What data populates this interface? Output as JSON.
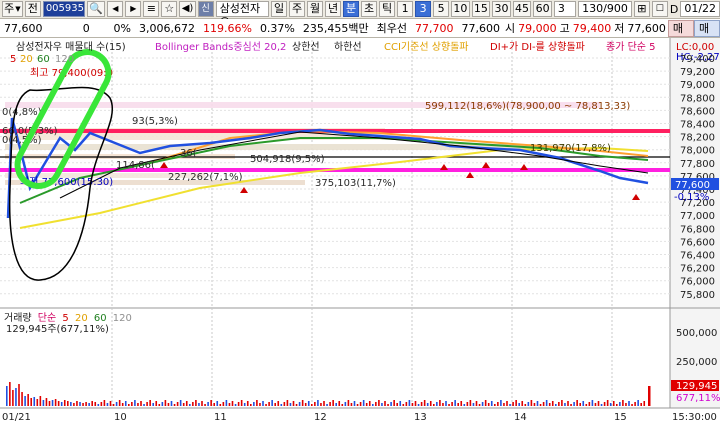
{
  "toolbar": {
    "label_ju": "주",
    "dropdown_arrow": "▼",
    "label_jeon": "전",
    "code": "005935",
    "stock_name": "삼성전자우",
    "periods": [
      "일",
      "주",
      "월",
      "년",
      "분",
      "초",
      "틱"
    ],
    "minutes": [
      "1",
      "3",
      "5",
      "10",
      "15",
      "30",
      "45",
      "60"
    ],
    "interval": "3",
    "count": "130/900",
    "date": "01/22",
    "d_label": "D"
  },
  "quote": {
    "price": "77,600",
    "change": "0",
    "change_pct": "0%",
    "volume": "3,006,672",
    "vol_ratio": "119.66%",
    "turnover_pct": "0.37%",
    "amount": "235,455백만",
    "best_label": "최우선",
    "best_ask": "77,700",
    "best_bid": "77,600",
    "open_label": "시",
    "open": "79,000",
    "high_label": "고",
    "high": "79,400",
    "low_label": "저",
    "low": "77,600",
    "buy": "매수",
    "sell": "매도"
  },
  "legend": {
    "title": "삼성전자우 매물대 수(15)",
    "bb": "Bollinger Bands중심선 20,2",
    "upper": "상한선",
    "lower": "하한선",
    "cci": "CCI기준선 상향돌파",
    "di": "DI+가 DI-를 상향돌파",
    "ma": "종가 단순 5",
    "lc": "LC:0,00",
    "hc": "HC:-2,27"
  },
  "ma_periods": [
    "5",
    "20",
    "60",
    "120"
  ],
  "annotations": {
    "max": "최고 79,400(09:0",
    "min": "최저 77,600(15:30)",
    "vp1": "599,112(18,6%)(78,900,00 ~ 78,813,33)",
    "vp2": "131,970(17,8%)",
    "vp3": "504,918(9,5%)",
    "vp4": "227,262(7,1%)",
    "vp5": "375,103(11,7%)",
    "vp6": "93(5,3%)",
    "vp_left": "0(4,8%)",
    "vp_left2": "0(4,5%)",
    "vp_left3": "66,0(5,3%)",
    "vp_mid": "36(",
    "vp_mid2": "114,86(",
    "cur_price": "77,600",
    "cur_change": "-0,13%"
  },
  "price_axis": [
    "79,400",
    "79,200",
    "79,000",
    "78,800",
    "78,600",
    "78,400",
    "78,200",
    "78,000",
    "77,800",
    "77,600",
    "77,400",
    "77,200",
    "77,000",
    "76,800",
    "76,600",
    "76,400",
    "76,200",
    "76,000",
    "75,800"
  ],
  "volume_panel": {
    "title_parts": [
      "거래량",
      "단순",
      "5",
      "20",
      "60",
      "120"
    ],
    "value": "129,945주(677,11%)",
    "axis": [
      "500,000",
      "250,000"
    ],
    "cur_value": "129,945",
    "cur_pct": "677,11%"
  },
  "time_axis": {
    "start": "01/21",
    "labels": [
      "10",
      "11",
      "12",
      "13",
      "14",
      "15"
    ],
    "end": "15:30:00"
  },
  "colors": {
    "toolbar_bg": "#ece9e0",
    "up": "#e00000",
    "down": "#0000e0",
    "highlight_line": "#ff2060",
    "magenta_line": "#ff20e0",
    "green_ring": "#39e639"
  }
}
